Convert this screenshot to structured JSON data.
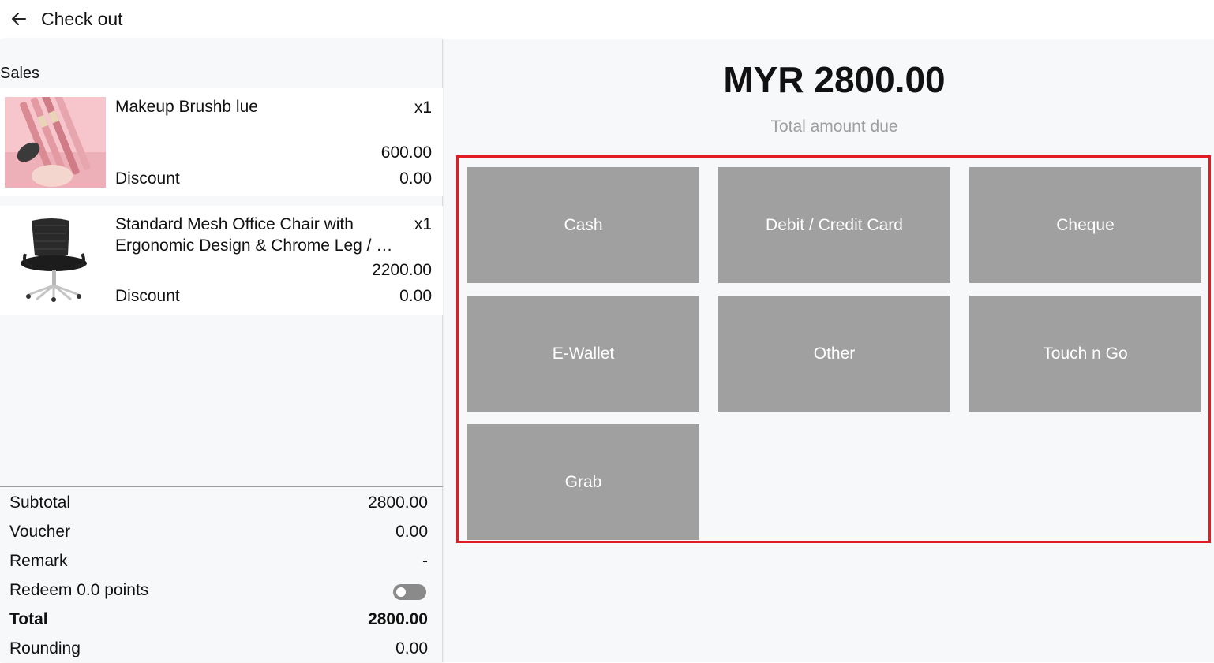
{
  "header": {
    "title": "Check out",
    "back_icon": "arrow-left-icon"
  },
  "sales": {
    "label": "Sales",
    "items": [
      {
        "name": "Makeup Brushb lue",
        "qty": "x1",
        "price": "600.00",
        "discount_label": "Discount",
        "discount": "0.00",
        "image_icon": "makeup-brush-image"
      },
      {
        "name": "Standard Mesh Office Chair with Ergonomic Design & Chrome Leg / …",
        "qty": "x1",
        "price": "2200.00",
        "discount_label": "Discount",
        "discount": "0.00",
        "image_icon": "office-chair-image"
      }
    ]
  },
  "summary": {
    "subtotal_label": "Subtotal",
    "subtotal": "2800.00",
    "voucher_label": "Voucher",
    "voucher": "0.00",
    "remark_label": "Remark",
    "remark": "-",
    "redeem_label": "Redeem 0.0 points",
    "redeem_enabled": false,
    "total_label": "Total",
    "total": "2800.00",
    "rounding_label": "Rounding",
    "rounding": "0.00"
  },
  "payment": {
    "amount": "MYR 2800.00",
    "amount_caption": "Total amount due",
    "methods": [
      "Cash",
      "Debit / Credit Card",
      "Cheque",
      "E-Wallet",
      "Other",
      "Touch n Go",
      "Grab"
    ]
  },
  "colors": {
    "button_bg": "#a0a0a0",
    "highlight_border": "#e31b23",
    "panel_bg": "#f7f8fa"
  }
}
